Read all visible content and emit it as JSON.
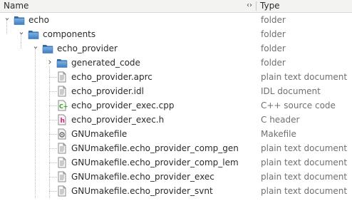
{
  "header": {
    "name_label": "Name",
    "sort_indicator": "‹›",
    "type_label": "Type"
  },
  "rows": [
    {
      "name": "echo",
      "type": "folder",
      "icon": "folder-icon",
      "expander": "expanded"
    },
    {
      "name": "components",
      "type": "folder",
      "icon": "folder-icon",
      "expander": "expanded"
    },
    {
      "name": "echo_provider",
      "type": "folder",
      "icon": "folder-icon",
      "expander": "expanded"
    },
    {
      "name": "generated_code",
      "type": "folder",
      "icon": "folder-icon",
      "expander": "collapsed"
    },
    {
      "name": "echo_provider.aprc",
      "type": "plain text document",
      "icon": "text-file-icon"
    },
    {
      "name": "echo_provider.idl",
      "type": "IDL document",
      "icon": "text-file-icon"
    },
    {
      "name": "echo_provider_exec.cpp",
      "type": "C++ source code",
      "icon": "cpp-file-icon"
    },
    {
      "name": "echo_provider_exec.h",
      "type": "C header",
      "icon": "h-file-icon"
    },
    {
      "name": "GNUmakefile",
      "type": "Makefile",
      "icon": "makefile-icon"
    },
    {
      "name": "GNUmakefile.echo_provider_comp_gen",
      "type": "plain text document",
      "icon": "text-file-icon"
    },
    {
      "name": "GNUmakefile.echo_provider_comp_lem",
      "type": "plain text document",
      "icon": "text-file-icon"
    },
    {
      "name": "GNUmakefile.echo_provider_exec",
      "type": "plain text document",
      "icon": "text-file-icon"
    },
    {
      "name": "GNUmakefile.echo_provider_svnt",
      "type": "plain text document",
      "icon": "text-file-icon"
    }
  ]
}
